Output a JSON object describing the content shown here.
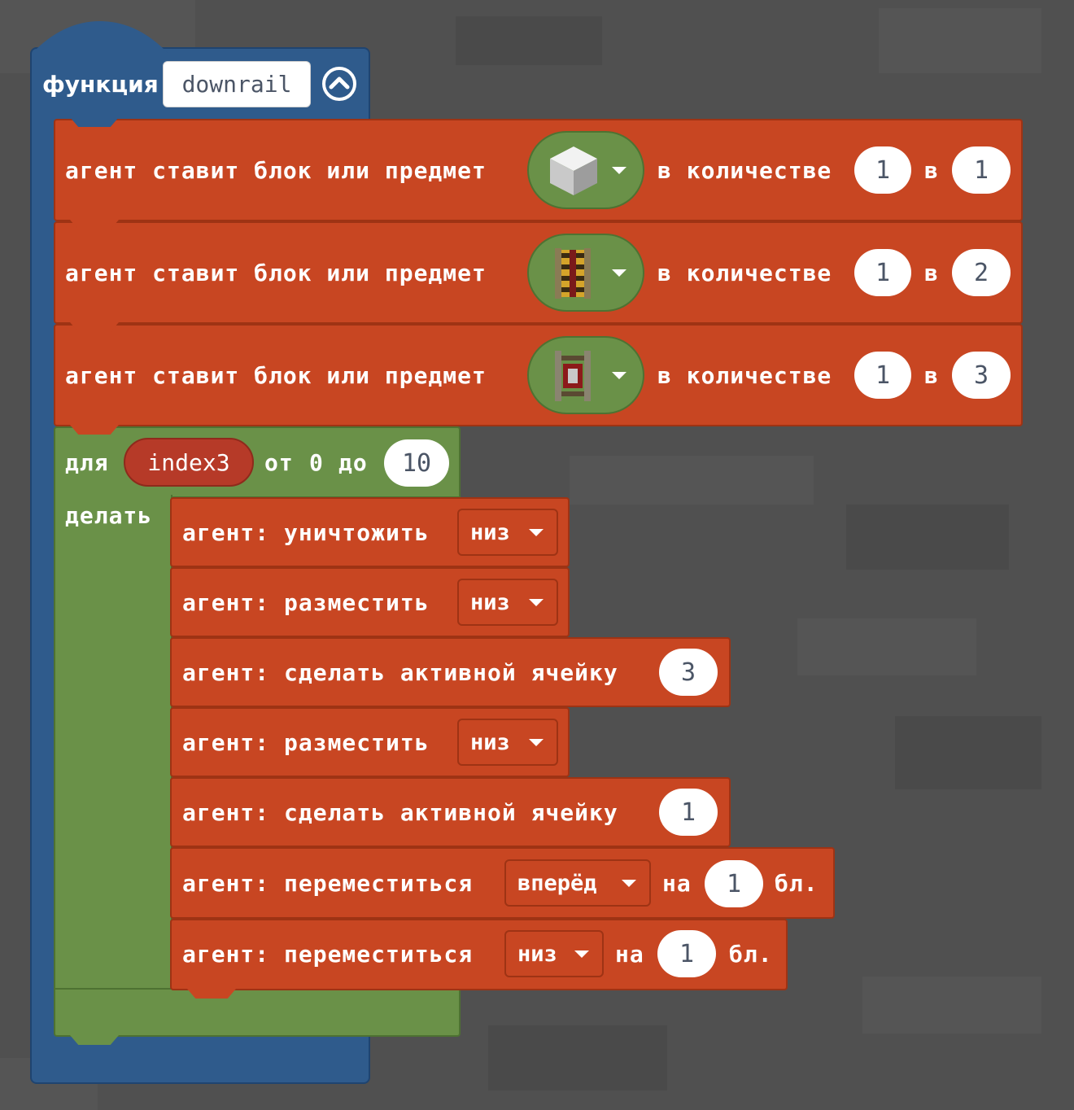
{
  "function_block": {
    "keyword": "функция",
    "name": "downrail",
    "collapse_icon": "chevron-up-circle-icon"
  },
  "place_blocks": [
    {
      "label": "агент ставит блок или предмет",
      "item": "iron-block-icon",
      "qty_label": "в количестве",
      "qty": "1",
      "slot_label": "в",
      "slot": "1"
    },
    {
      "label": "агент ставит блок или предмет",
      "item": "powered-rail-icon",
      "qty_label": "в количестве",
      "qty": "1",
      "slot_label": "в",
      "slot": "2"
    },
    {
      "label": "агент ставит блок или предмет",
      "item": "redstone-torch-rail-icon",
      "qty_label": "в количестве",
      "qty": "1",
      "slot_label": "в",
      "slot": "3"
    }
  ],
  "loop": {
    "keyword": "для",
    "variable": "index3",
    "from_label": "от",
    "from": "0",
    "to_label": "до",
    "to": "10",
    "do_label": "делать"
  },
  "inner_blocks": {
    "destroy": {
      "label": "агент: уничтожить",
      "direction": "низ"
    },
    "place1": {
      "label": "агент: разместить",
      "direction": "низ"
    },
    "slot1": {
      "label": "агент: сделать активной ячейку",
      "value": "3"
    },
    "place2": {
      "label": "агент: разместить",
      "direction": "низ"
    },
    "slot2": {
      "label": "агент: сделать активной ячейку",
      "value": "1"
    },
    "move1": {
      "label": "агент: переместиться",
      "direction": "вперёд",
      "by": "на",
      "amount": "1",
      "unit": "бл."
    },
    "move2": {
      "label": "агент: переместиться",
      "direction": "низ",
      "by": "на",
      "amount": "1",
      "unit": "бл."
    }
  },
  "colors": {
    "function": "#2f5b8c",
    "agent_action": "#c84622",
    "loop": "#6a9148",
    "background": "#505050"
  }
}
